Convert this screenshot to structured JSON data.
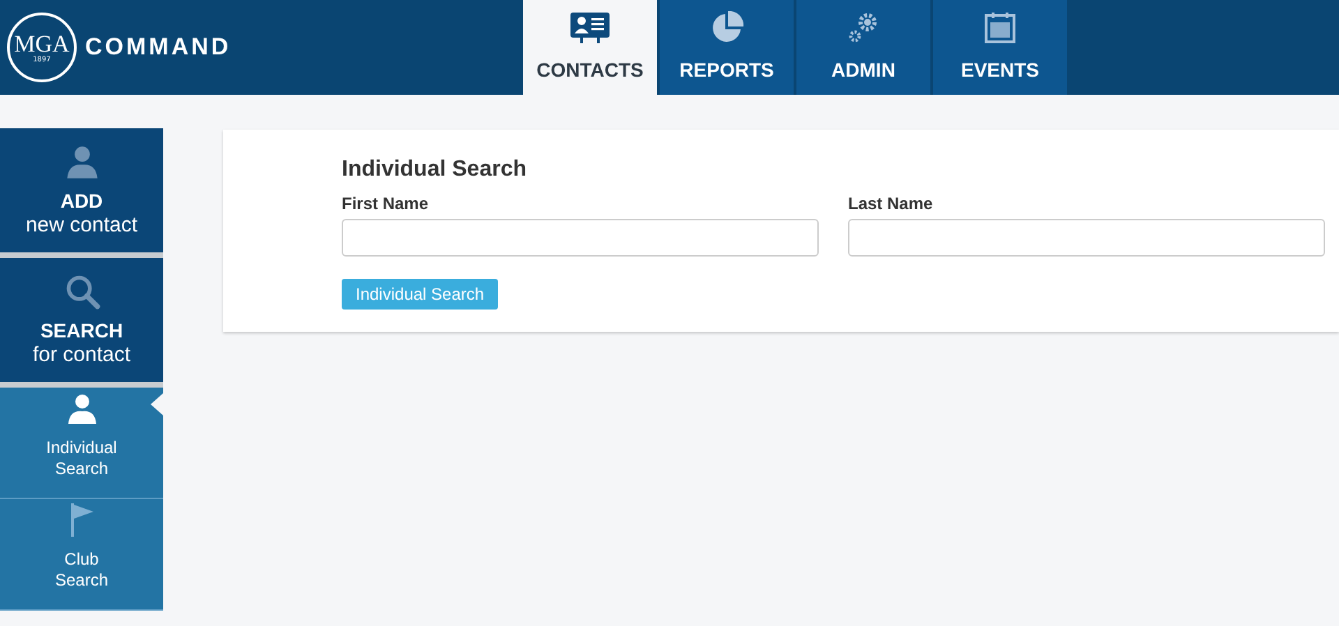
{
  "header": {
    "logo_text": "MGA",
    "logo_year": "1897",
    "app_name": "COMMAND"
  },
  "tabs": [
    {
      "label": "CONTACTS",
      "kind": "card",
      "selected": true
    },
    {
      "label": "REPORTS",
      "kind": "pie",
      "selected": false
    },
    {
      "label": "ADMIN",
      "kind": "gears",
      "selected": false
    },
    {
      "label": "EVENTS",
      "kind": "calendar",
      "selected": false
    }
  ],
  "sidebar": {
    "actions": [
      {
        "title": "ADD",
        "subtitle": "new contact",
        "kind": "person"
      },
      {
        "title": "SEARCH",
        "subtitle": "for contact",
        "kind": "search"
      }
    ],
    "items": [
      {
        "label": "Individual\nSearch",
        "kind": "person",
        "selected": true
      },
      {
        "label": "Club\nSearch",
        "kind": "flag",
        "selected": false
      }
    ]
  },
  "form": {
    "title": "Individual Search",
    "fields": [
      {
        "label": "First Name"
      },
      {
        "label": "Last Name"
      }
    ],
    "button": "Individual Search"
  }
}
